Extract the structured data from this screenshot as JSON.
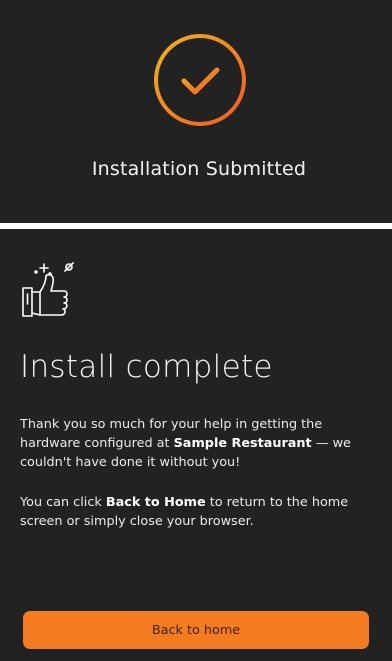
{
  "submitted": {
    "title": "Installation Submitted",
    "icon": "checkmark-circle-icon"
  },
  "complete": {
    "icon": "thumbs-up-icon",
    "title": "Install complete",
    "para1_a": "Thank you so much for your help in getting the hardware configured at ",
    "restaurant": "Sample Restaurant",
    "para1_b": " — we couldn't have done it without you!",
    "para2_a": "You can click ",
    "back_label_bold": "Back to Home",
    "para2_b": " to return to the home screen or simply close your browser."
  },
  "button": {
    "label": "Back to home"
  },
  "colors": {
    "background": "#222222",
    "accent": "#f47b20",
    "gradient_start": "#f0a020",
    "gradient_end": "#f05a28"
  }
}
